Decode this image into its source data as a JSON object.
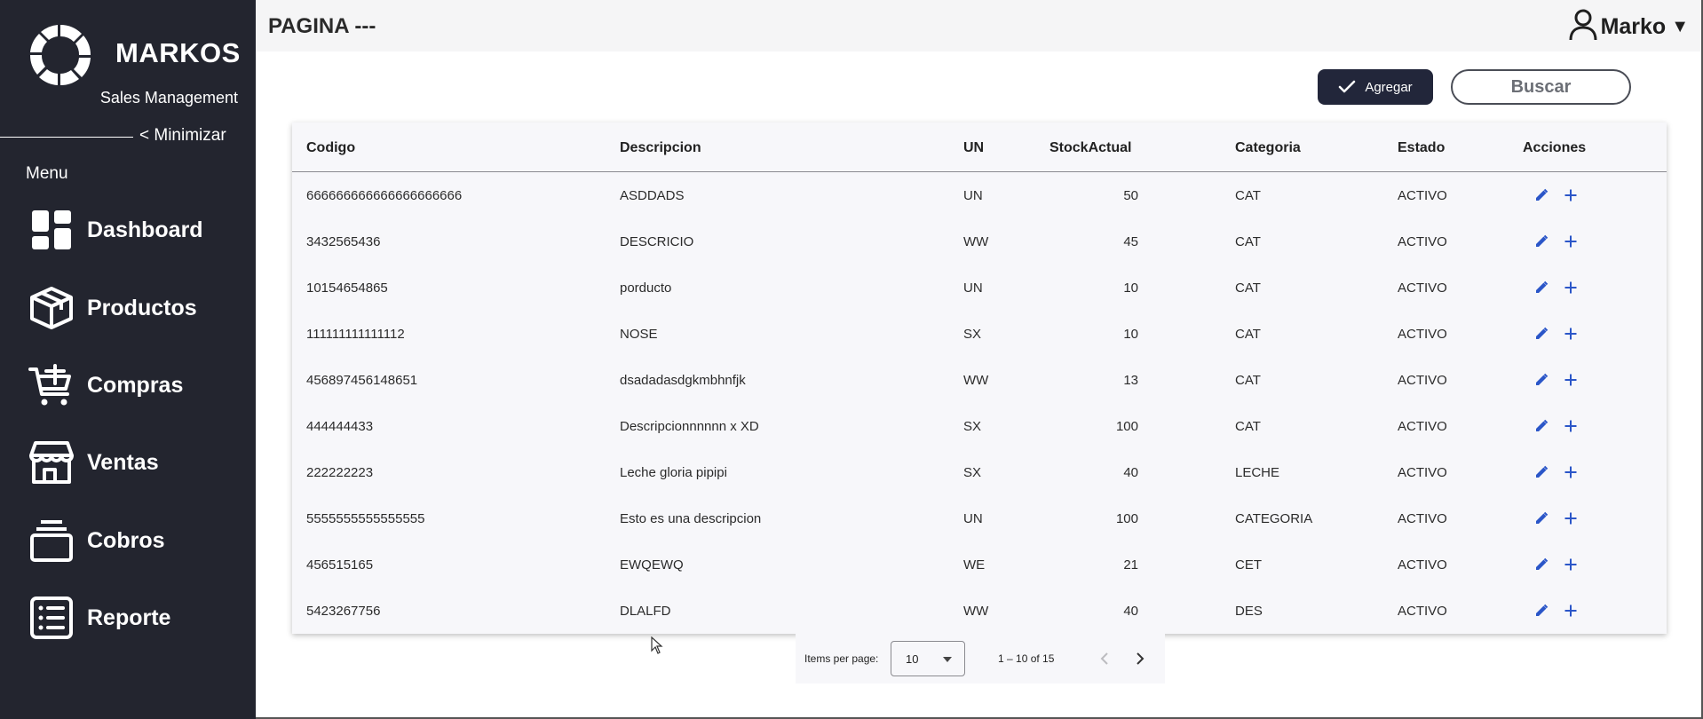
{
  "sidebar": {
    "brand": "MARKOS",
    "subtitle": "Sales Management",
    "minimize": "< Minimizar",
    "menu_label": "Menu",
    "items": [
      {
        "label": "Dashboard",
        "icon": "dashboard-icon"
      },
      {
        "label": "Productos",
        "icon": "box-icon"
      },
      {
        "label": "Compras",
        "icon": "cart-plus-icon"
      },
      {
        "label": "Ventas",
        "icon": "store-icon"
      },
      {
        "label": "Cobros",
        "icon": "stack-icon"
      },
      {
        "label": "Reporte",
        "icon": "report-list-icon"
      }
    ]
  },
  "header": {
    "title": "PAGINA ---",
    "user": "Marko"
  },
  "actions": {
    "add_label": "Agregar",
    "search_label": "Buscar"
  },
  "table": {
    "columns": [
      "Codigo",
      "Descripcion",
      "UN",
      "StockActual",
      "Categoria",
      "Estado",
      "Acciones"
    ],
    "rows": [
      {
        "codigo": "666666666666666666666",
        "descripcion": "ASDDADS",
        "un": "UN",
        "stock": "50",
        "categoria": "CAT",
        "estado": "ACTIVO"
      },
      {
        "codigo": "3432565436",
        "descripcion": "DESCRICIO",
        "un": "WW",
        "stock": "45",
        "categoria": "CAT",
        "estado": "ACTIVO"
      },
      {
        "codigo": "10154654865",
        "descripcion": "porducto",
        "un": "UN",
        "stock": "10",
        "categoria": "CAT",
        "estado": "ACTIVO"
      },
      {
        "codigo": "111111111111112",
        "descripcion": "NOSE",
        "un": "SX",
        "stock": "10",
        "categoria": "CAT",
        "estado": "ACTIVO"
      },
      {
        "codigo": "456897456148651",
        "descripcion": "dsadadasdgkmbhnfjk",
        "un": "WW",
        "stock": "13",
        "categoria": "CAT",
        "estado": "ACTIVO"
      },
      {
        "codigo": "444444433",
        "descripcion": "Descripcionnnnnn x XD",
        "un": "SX",
        "stock": "100",
        "categoria": "CAT",
        "estado": "ACTIVO"
      },
      {
        "codigo": "222222223",
        "descripcion": "Leche gloria pipipi",
        "un": "SX",
        "stock": "40",
        "categoria": "LECHE",
        "estado": "ACTIVO"
      },
      {
        "codigo": "5555555555555555",
        "descripcion": "Esto es una descripcion",
        "un": "UN",
        "stock": "100",
        "categoria": "CATEGORIA",
        "estado": "ACTIVO"
      },
      {
        "codigo": "456515165",
        "descripcion": "EWQEWQ",
        "un": "WE",
        "stock": "21",
        "categoria": "CET",
        "estado": "ACTIVO"
      },
      {
        "codigo": "5423267756",
        "descripcion": "DLALFD",
        "un": "WW",
        "stock": "40",
        "categoria": "DES",
        "estado": "ACTIVO"
      }
    ]
  },
  "paginator": {
    "items_per_page_label": "Items per page:",
    "items_per_page": "10",
    "range": "1 – 10 of 15"
  },
  "colors": {
    "sidebar_bg": "#23252f",
    "action_icon": "#2b56c8",
    "add_button_bg": "#22263a"
  }
}
